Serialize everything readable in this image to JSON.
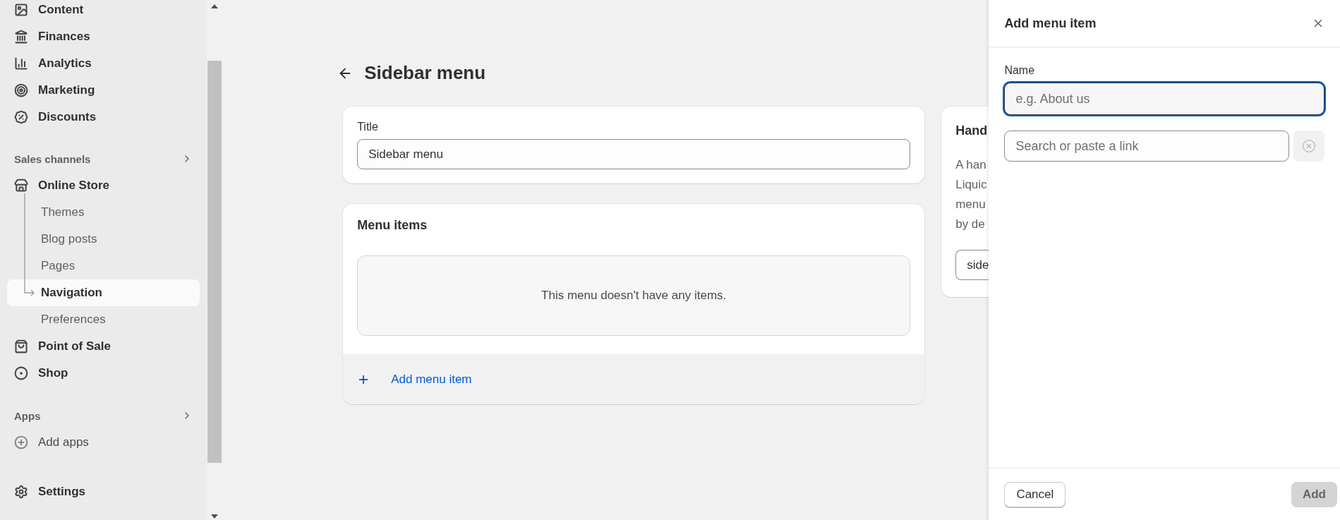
{
  "sidebar": {
    "groups": [
      {
        "items": [
          {
            "label": "Content",
            "selected": false
          },
          {
            "label": "Finances",
            "selected": false
          },
          {
            "label": "Analytics",
            "selected": false
          },
          {
            "label": "Marketing",
            "selected": false
          },
          {
            "label": "Discounts",
            "selected": false
          }
        ]
      },
      {
        "header": "Sales channels",
        "items": [
          {
            "label": "Online Store",
            "selected": false,
            "children": [
              {
                "label": "Themes",
                "selected": false
              },
              {
                "label": "Blog posts",
                "selected": false
              },
              {
                "label": "Pages",
                "selected": false
              },
              {
                "label": "Navigation",
                "selected": true
              },
              {
                "label": "Preferences",
                "selected": false
              }
            ]
          },
          {
            "label": "Point of Sale",
            "selected": false
          },
          {
            "label": "Shop",
            "selected": false
          }
        ]
      },
      {
        "header": "Apps",
        "items": [
          {
            "label": "Add apps",
            "selected": false
          }
        ]
      },
      {
        "items": [
          {
            "label": "Settings",
            "selected": false
          }
        ]
      }
    ]
  },
  "page": {
    "title": "Sidebar menu",
    "title_card": {
      "label": "Title",
      "value": "Sidebar menu"
    },
    "menu_items_card": {
      "title": "Menu items",
      "empty_text": "This menu doesn't have any items.",
      "add_link": "Add menu item"
    },
    "handle_card": {
      "title": "Hand",
      "lines": [
        "A han",
        "Liquic",
        "menu",
        "by de"
      ],
      "value": "side"
    }
  },
  "panel": {
    "title": "Add menu item",
    "name_label": "Name",
    "name_placeholder": "e.g. About us",
    "link_placeholder": "Search or paste a link",
    "cancel": "Cancel",
    "add": "Add",
    "add_disabled": true
  }
}
